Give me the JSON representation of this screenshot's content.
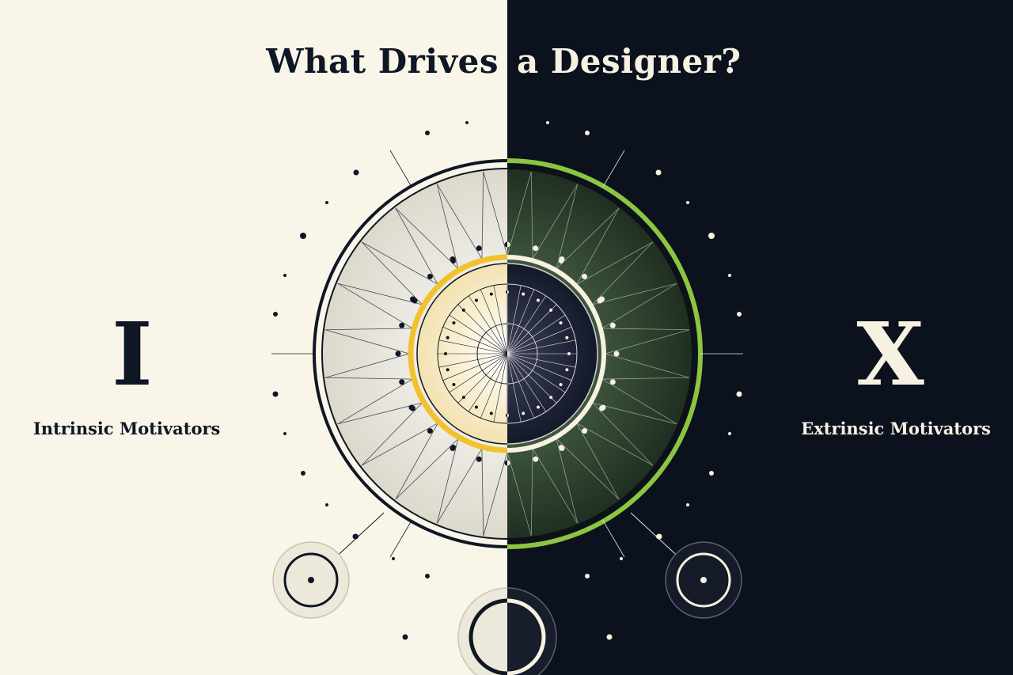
{
  "title": {
    "left": "What Drives",
    "right": "a Designer?"
  },
  "intrinsic": {
    "symbol": "I",
    "label": "Intrinsic Motivators"
  },
  "extrinsic": {
    "symbol": "X",
    "label": "Extrinsic Motivators"
  },
  "colors": {
    "cream": "#f9f5e8",
    "navy": "#0b111d",
    "ink": "#0f1624",
    "yellow_accent": "#f2c22e",
    "green_accent": "#8cc63f",
    "dark_green": "#2a3d2c"
  },
  "graphic": {
    "name": "motivation-wheel-icon",
    "spokes": 24,
    "inner_dots": 24
  }
}
